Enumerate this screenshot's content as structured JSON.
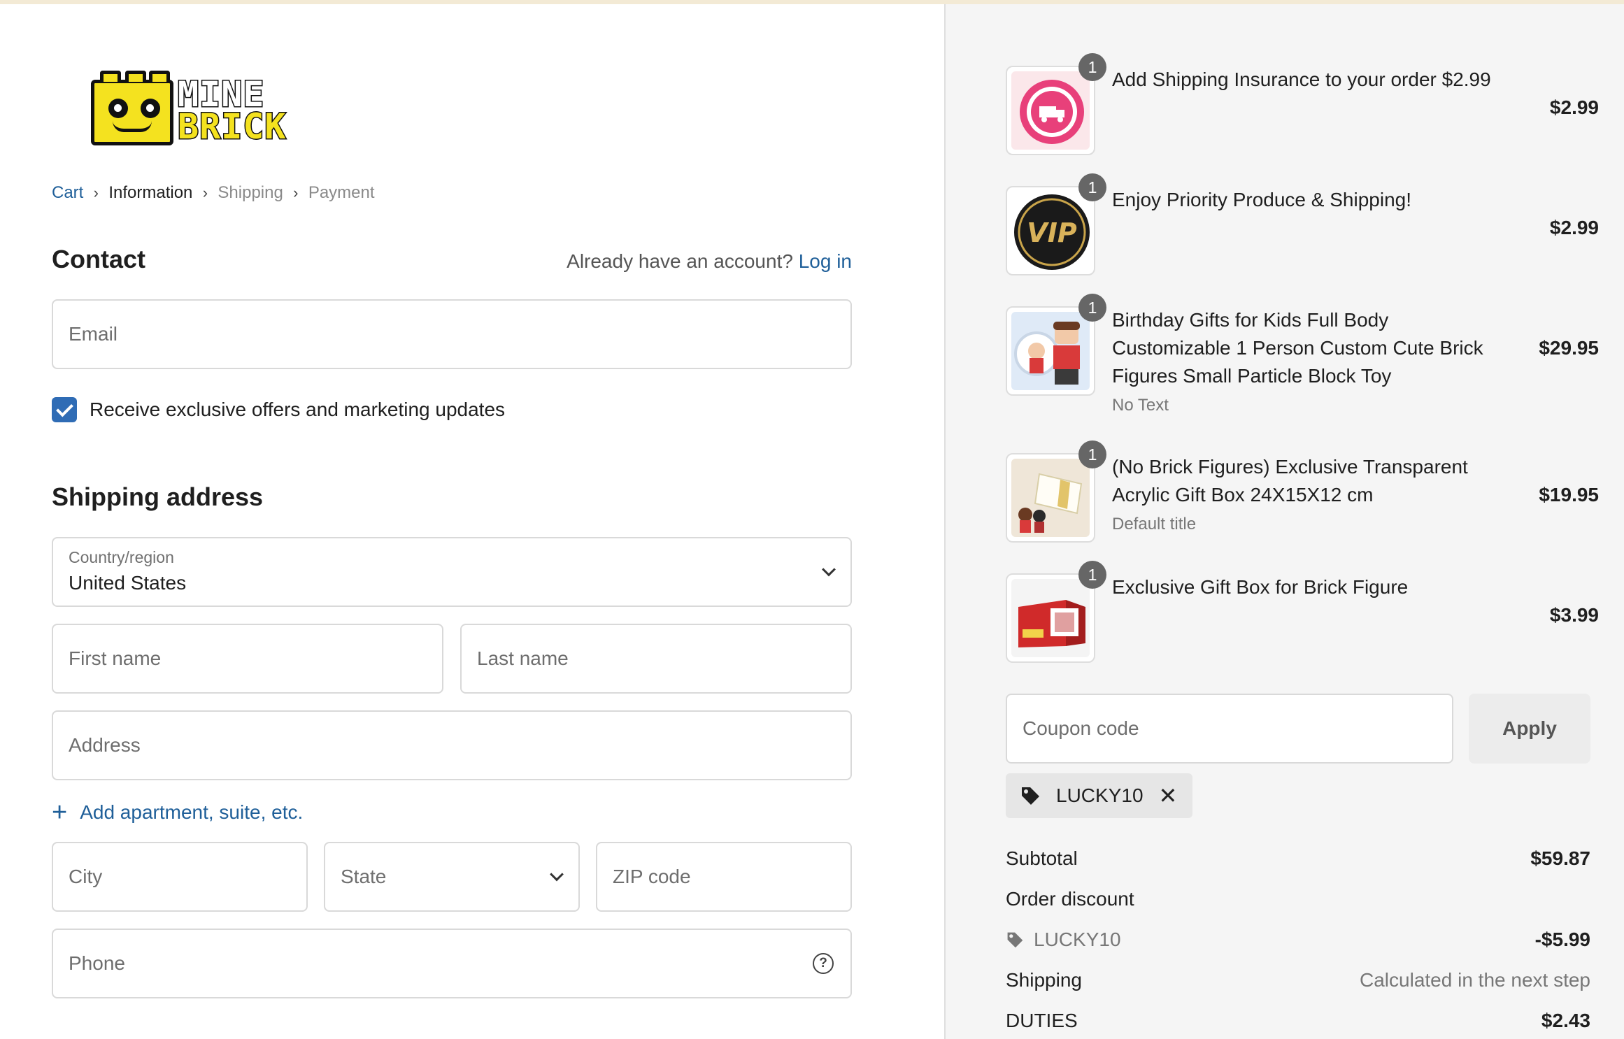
{
  "brand": {
    "logo_line1": "MINE",
    "logo_line2": "BRICK"
  },
  "breadcrumb": [
    "Cart",
    "Information",
    "Shipping",
    "Payment"
  ],
  "contact": {
    "heading": "Contact",
    "account_prompt": "Already have an account?",
    "login_label": "Log in",
    "email_placeholder": "Email",
    "marketing_label": "Receive exclusive offers and marketing updates",
    "marketing_checked": true
  },
  "shipping": {
    "heading": "Shipping address",
    "country_label": "Country/region",
    "country_value": "United States",
    "first_name_placeholder": "First name",
    "last_name_placeholder": "Last name",
    "address_placeholder": "Address",
    "add_apartment_label": "Add apartment, suite, etc.",
    "city_placeholder": "City",
    "state_placeholder": "State",
    "zip_placeholder": "ZIP code",
    "phone_placeholder": "Phone"
  },
  "cart": {
    "items": [
      {
        "qty": "1",
        "name": "Add Shipping Insurance to your order $2.99",
        "variant": "",
        "price": "$2.99",
        "icon": "insurance-badge"
      },
      {
        "qty": "1",
        "name": "Enjoy Priority Produce & Shipping!",
        "variant": "",
        "price": "$2.99",
        "icon": "vip-badge",
        "badge_text": "VIP"
      },
      {
        "qty": "1",
        "name": "Birthday Gifts for Kids Full Body Customizable 1 Person Custom Cute Brick Figures Small Particle Block Toy",
        "variant": "No Text",
        "price": "$29.95",
        "icon": "brick-figure"
      },
      {
        "qty": "1",
        "name": "(No Brick Figures) Exclusive Transparent Acrylic Gift Box 24X15X12 cm",
        "variant": "Default title",
        "price": "$19.95",
        "icon": "acrylic-box"
      },
      {
        "qty": "1",
        "name": "Exclusive Gift Box for Brick Figure",
        "variant": "",
        "price": "$3.99",
        "icon": "gift-box"
      }
    ],
    "coupon_placeholder": "Coupon code",
    "apply_label": "Apply",
    "applied_code": "LUCKY10"
  },
  "summary": {
    "subtotal_label": "Subtotal",
    "subtotal_value": "$59.87",
    "order_discount_label": "Order discount",
    "discount_code": "LUCKY10",
    "discount_value": "-$5.99",
    "shipping_label": "Shipping",
    "shipping_value": "Calculated in the next step",
    "duties_label": "DUTIES",
    "duties_value": "$2.43"
  },
  "colors": {
    "link": "#1f5f99",
    "checkbox": "#2f6cb5",
    "logo_yellow": "#f4e21f"
  }
}
